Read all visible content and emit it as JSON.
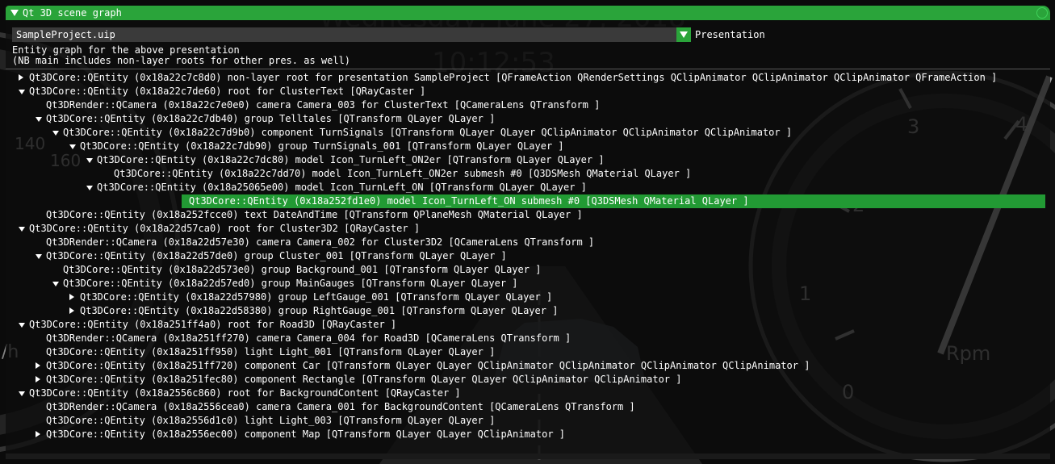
{
  "background": {
    "date": "Wednesday, June 27, 2018",
    "time": "10:12:53",
    "left_gauge_numbers": [
      "140",
      "160"
    ],
    "right_gauge_numbers": [
      "4",
      "3",
      "2",
      "1",
      "0"
    ],
    "right_gauge_unit": "Rpm",
    "left_gauge_unit_fragment": "/h"
  },
  "window": {
    "title": "Qt 3D scene graph",
    "combo_value": "SampleProject.uip",
    "combo_label": "Presentation",
    "info_line1": "Entity graph for the above presentation",
    "info_line2": "(NB main includes non-layer roots for other pres. as well)",
    "accent_color": "#2aa43a"
  },
  "tree": [
    {
      "depth": 0,
      "arrow": "right",
      "text": "Qt3DCore::QEntity (0x18a22c7c8d0) non-layer root for presentation SampleProject [QFrameAction QRenderSettings QClipAnimator QClipAnimator QClipAnimator QFrameAction ]"
    },
    {
      "depth": 0,
      "arrow": "down",
      "text": "Qt3DCore::QEntity (0x18a22c7de60) root for ClusterText [QRayCaster ]"
    },
    {
      "depth": 1,
      "arrow": "none",
      "text": "Qt3DRender::QCamera (0x18a22c7e0e0) camera Camera_003 for ClusterText [QCameraLens QTransform ]"
    },
    {
      "depth": 1,
      "arrow": "down",
      "text": "Qt3DCore::QEntity (0x18a22c7db40) group Telltales [QTransform QLayer QLayer ]"
    },
    {
      "depth": 2,
      "arrow": "down",
      "text": "Qt3DCore::QEntity (0x18a22c7d9b0) component TurnSignals [QTransform QLayer QLayer QClipAnimator QClipAnimator QClipAnimator ]"
    },
    {
      "depth": 3,
      "arrow": "down",
      "text": "Qt3DCore::QEntity (0x18a22c7db90) group TurnSignals_001 [QTransform QLayer QLayer ]"
    },
    {
      "depth": 4,
      "arrow": "down",
      "text": "Qt3DCore::QEntity (0x18a22c7dc80) model Icon_TurnLeft_ON2er [QTransform QLayer QLayer ]"
    },
    {
      "depth": 5,
      "arrow": "none",
      "text": "Qt3DCore::QEntity (0x18a22c7dd70) model Icon_TurnLeft_ON2er submesh #0 [Q3DSMesh QMaterial QLayer ]"
    },
    {
      "depth": 4,
      "arrow": "down",
      "text": "Qt3DCore::QEntity (0x18a25065e00) model Icon_TurnLeft_ON [QTransform QLayer QLayer ]"
    },
    {
      "depth": 5,
      "arrow": "none",
      "selected": true,
      "text": "Qt3DCore::QEntity (0x18a252fd1e0) model Icon_TurnLeft_ON submesh #0 [Q3DSMesh QMaterial QLayer ]"
    },
    {
      "depth": 1,
      "arrow": "none",
      "text": "Qt3DCore::QEntity (0x18a252fcce0) text DateAndTime [QTransform QPlaneMesh QMaterial QLayer ]"
    },
    {
      "depth": 0,
      "arrow": "down",
      "text": "Qt3DCore::QEntity (0x18a22d57ca0) root for Cluster3D2 [QRayCaster ]"
    },
    {
      "depth": 1,
      "arrow": "none",
      "text": "Qt3DRender::QCamera (0x18a22d57e30) camera Camera_002 for Cluster3D2 [QCameraLens QTransform ]"
    },
    {
      "depth": 1,
      "arrow": "down",
      "text": "Qt3DCore::QEntity (0x18a22d57de0) group Cluster_001 [QTransform QLayer QLayer ]"
    },
    {
      "depth": 2,
      "arrow": "none",
      "text": "Qt3DCore::QEntity (0x18a22d573e0) group Background_001 [QTransform QLayer QLayer ]"
    },
    {
      "depth": 2,
      "arrow": "down",
      "text": "Qt3DCore::QEntity (0x18a22d57ed0) group MainGauges [QTransform QLayer QLayer ]"
    },
    {
      "depth": 3,
      "arrow": "right",
      "text": "Qt3DCore::QEntity (0x18a22d57980) group LeftGauge_001 [QTransform QLayer QLayer ]"
    },
    {
      "depth": 3,
      "arrow": "right",
      "text": "Qt3DCore::QEntity (0x18a22d58380) group RightGauge_001 [QTransform QLayer QLayer ]"
    },
    {
      "depth": 0,
      "arrow": "down",
      "text": "Qt3DCore::QEntity (0x18a251ff4a0) root for Road3D [QRayCaster ]"
    },
    {
      "depth": 1,
      "arrow": "none",
      "text": "Qt3DRender::QCamera (0x18a251ff270) camera Camera_004 for Road3D [QCameraLens QTransform ]"
    },
    {
      "depth": 1,
      "arrow": "none",
      "text": "Qt3DCore::QEntity (0x18a251ff950) light Light_001 [QTransform QLayer QLayer ]"
    },
    {
      "depth": 1,
      "arrow": "right",
      "text": "Qt3DCore::QEntity (0x18a251ff720) component Car [QTransform QLayer QLayer QClipAnimator QClipAnimator QClipAnimator QClipAnimator ]"
    },
    {
      "depth": 1,
      "arrow": "right",
      "text": "Qt3DCore::QEntity (0x18a251fec80) component Rectangle [QTransform QLayer QLayer QClipAnimator QClipAnimator ]"
    },
    {
      "depth": 0,
      "arrow": "down",
      "text": "Qt3DCore::QEntity (0x18a2556c860) root for BackgroundContent [QRayCaster ]"
    },
    {
      "depth": 1,
      "arrow": "none",
      "text": "Qt3DRender::QCamera (0x18a2556cea0) camera Camera_001 for BackgroundContent [QCameraLens QTransform ]"
    },
    {
      "depth": 1,
      "arrow": "none",
      "text": "Qt3DCore::QEntity (0x18a2556d1c0) light Light_003 [QTransform QLayer QLayer ]"
    },
    {
      "depth": 1,
      "arrow": "right",
      "text": "Qt3DCore::QEntity (0x18a2556ec00) component Map [QTransform QLayer QLayer QClipAnimator ]"
    }
  ]
}
